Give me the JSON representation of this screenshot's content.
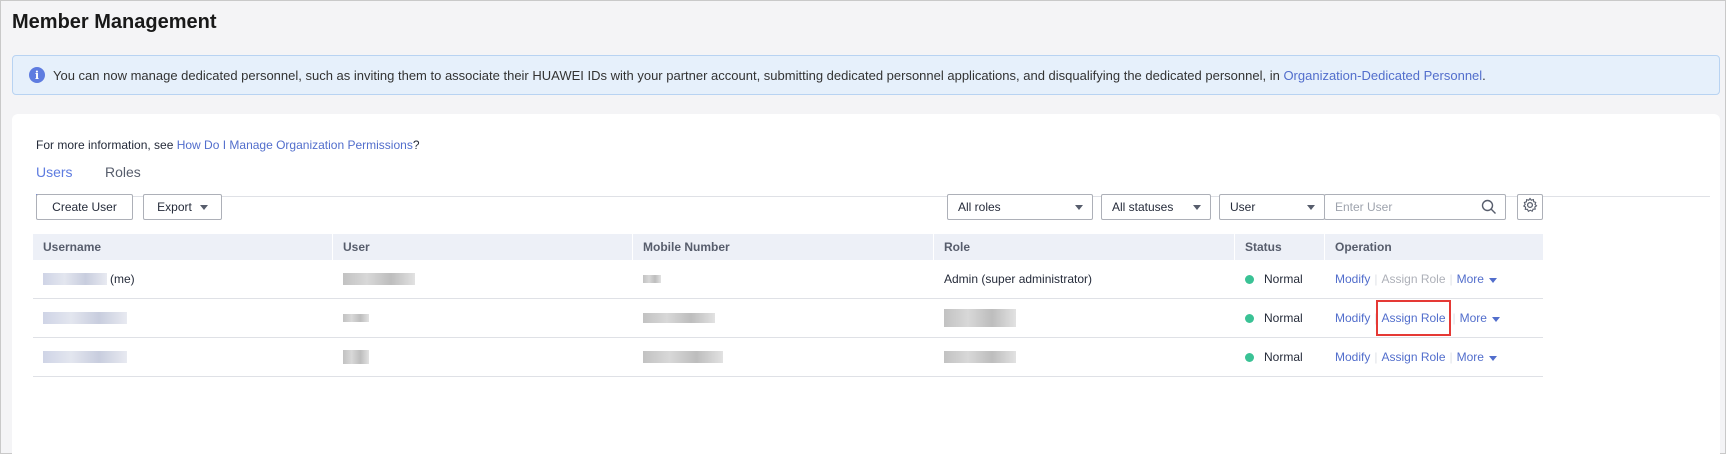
{
  "page": {
    "title": "Member Management"
  },
  "notice": {
    "text": "You can now manage dedicated personnel, such as inviting them to associate their HUAWEI IDs with your partner account, submitting dedicated personnel applications, and disqualifying the dedicated personnel, in ",
    "link": "Organization-Dedicated Personnel",
    "suffix": "."
  },
  "info": {
    "prefix": "For more information, see ",
    "link": "How Do I Manage Organization Permissions",
    "suffix": "?"
  },
  "tabs": [
    {
      "label": "Users",
      "active": true
    },
    {
      "label": "Roles",
      "active": false
    }
  ],
  "toolbar": {
    "create_user": "Create User",
    "export": "Export",
    "roles_filter": "All roles",
    "status_filter": "All statuses",
    "search_field": "User",
    "search_placeholder": "Enter User"
  },
  "table": {
    "headers": [
      "Username",
      "User",
      "Mobile Number",
      "Role",
      "Status",
      "Operation"
    ],
    "rows": [
      {
        "username_suffix": "(me)",
        "role": "Admin (super administrator)",
        "status": "Normal",
        "modify": "Modify",
        "assign": "Assign Role",
        "assign_disabled": true,
        "more": "More"
      },
      {
        "username_suffix": "",
        "role": "",
        "status": "Normal",
        "modify": "Modify",
        "assign": "Assign Role",
        "assign_disabled": false,
        "highlighted": true,
        "more": "More"
      },
      {
        "username_suffix": "",
        "role": "",
        "status": "Normal",
        "modify": "Modify",
        "assign": "Assign Role",
        "assign_disabled": false,
        "more": "More"
      }
    ]
  },
  "colors": {
    "accent": "#5e7ce0",
    "link": "#526ecc",
    "status_normal": "#3ac295",
    "highlight_box": "#e53935"
  }
}
